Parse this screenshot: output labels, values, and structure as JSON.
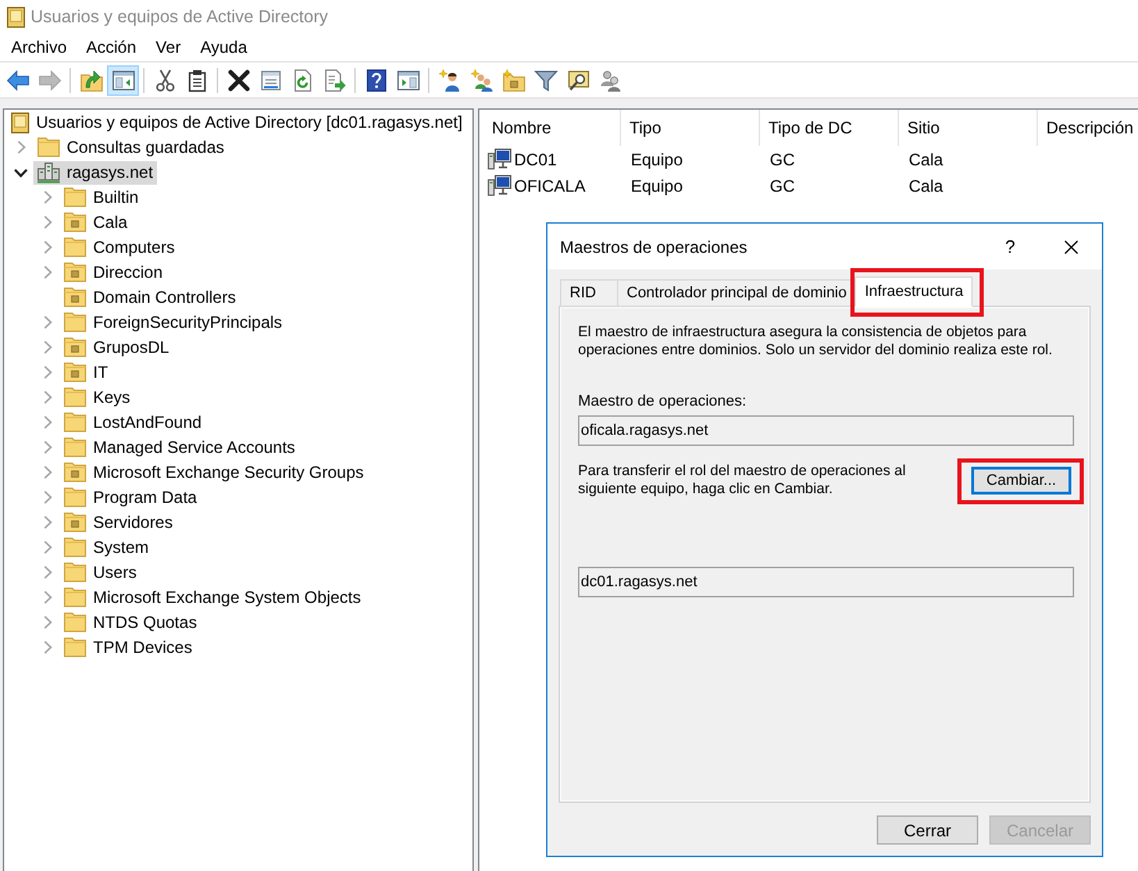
{
  "window": {
    "title": "Usuarios y equipos de Active Directory"
  },
  "menu": [
    "Archivo",
    "Acción",
    "Ver",
    "Ayuda"
  ],
  "toolbar": [
    {
      "kind": "button",
      "disabled": false,
      "pressed": false
    },
    {
      "kind": "button",
      "disabled": true,
      "pressed": false
    },
    {
      "kind": "separator"
    },
    {
      "kind": "button",
      "disabled": false,
      "pressed": false
    },
    {
      "kind": "button",
      "disabled": false,
      "pressed": true
    },
    {
      "kind": "separator"
    },
    {
      "kind": "button",
      "disabled": false,
      "pressed": false
    },
    {
      "kind": "button",
      "disabled": false,
      "pressed": false
    },
    {
      "kind": "separator"
    },
    {
      "kind": "button",
      "disabled": false,
      "pressed": false
    },
    {
      "kind": "button",
      "disabled": false,
      "pressed": false
    },
    {
      "kind": "button",
      "disabled": false,
      "pressed": false
    },
    {
      "kind": "button",
      "disabled": false,
      "pressed": false
    },
    {
      "kind": "separator"
    },
    {
      "kind": "button",
      "disabled": false,
      "pressed": false
    },
    {
      "kind": "button",
      "disabled": false,
      "pressed": false
    },
    {
      "kind": "separator"
    },
    {
      "kind": "button",
      "disabled": false,
      "pressed": false
    },
    {
      "kind": "button",
      "disabled": false,
      "pressed": false
    },
    {
      "kind": "button",
      "disabled": false,
      "pressed": false
    },
    {
      "kind": "button",
      "disabled": false,
      "pressed": false
    },
    {
      "kind": "button",
      "disabled": false,
      "pressed": false
    },
    {
      "kind": "button",
      "disabled": false,
      "pressed": false
    }
  ],
  "tree": {
    "root": {
      "label": "Usuarios y equipos de Active Directory [dc01.ragasys.net]",
      "selected": false
    },
    "items": [
      {
        "label": "Consultas guardadas",
        "kind": "folder",
        "expandable": true,
        "expanded": false,
        "selected": false
      },
      {
        "label": "ragasys.net",
        "kind": "domain",
        "expandable": true,
        "expanded": true,
        "selected": true,
        "children": [
          {
            "label": "Builtin",
            "kind": "folder",
            "expandable": true,
            "expanded": false,
            "selected": false
          },
          {
            "label": "Cala",
            "kind": "ou",
            "expandable": true,
            "expanded": false,
            "selected": false
          },
          {
            "label": "Computers",
            "kind": "folder",
            "expandable": true,
            "expanded": false,
            "selected": false
          },
          {
            "label": "Direccion",
            "kind": "ou",
            "expandable": true,
            "expanded": false,
            "selected": false
          },
          {
            "label": "Domain Controllers",
            "kind": "ou",
            "expandable": false,
            "selected": false
          },
          {
            "label": "ForeignSecurityPrincipals",
            "kind": "folder",
            "expandable": true,
            "expanded": false,
            "selected": false
          },
          {
            "label": "GruposDL",
            "kind": "ou",
            "expandable": true,
            "expanded": false,
            "selected": false
          },
          {
            "label": "IT",
            "kind": "ou",
            "expandable": true,
            "expanded": false,
            "selected": false
          },
          {
            "label": "Keys",
            "kind": "folder",
            "expandable": true,
            "expanded": false,
            "selected": false
          },
          {
            "label": "LostAndFound",
            "kind": "folder",
            "expandable": true,
            "expanded": false,
            "selected": false
          },
          {
            "label": "Managed Service Accounts",
            "kind": "folder",
            "expandable": true,
            "expanded": false,
            "selected": false
          },
          {
            "label": "Microsoft Exchange Security Groups",
            "kind": "ou",
            "expandable": true,
            "expanded": false,
            "selected": false
          },
          {
            "label": "Program Data",
            "kind": "folder",
            "expandable": true,
            "expanded": false,
            "selected": false
          },
          {
            "label": "Servidores",
            "kind": "ou",
            "expandable": true,
            "expanded": false,
            "selected": false
          },
          {
            "label": "System",
            "kind": "folder",
            "expandable": true,
            "expanded": false,
            "selected": false
          },
          {
            "label": "Users",
            "kind": "folder",
            "expandable": true,
            "expanded": false,
            "selected": false
          },
          {
            "label": "Microsoft Exchange System Objects",
            "kind": "folder",
            "expandable": true,
            "expanded": false,
            "selected": false
          },
          {
            "label": "NTDS Quotas",
            "kind": "folder",
            "expandable": true,
            "expanded": false,
            "selected": false
          },
          {
            "label": "TPM Devices",
            "kind": "folder",
            "expandable": true,
            "expanded": false,
            "selected": false
          }
        ]
      }
    ]
  },
  "list": {
    "columns": [
      "Nombre",
      "Tipo",
      "Tipo de DC",
      "Sitio",
      "Descripción"
    ],
    "rows": [
      {
        "cells": [
          "DC01",
          "Equipo",
          "GC",
          "Cala"
        ]
      },
      {
        "cells": [
          "OFICALA",
          "Equipo",
          "GC",
          "Cala"
        ]
      }
    ]
  },
  "dialog": {
    "title": "Maestros de operaciones",
    "help": "?",
    "tabs": [
      {
        "label": "RID",
        "selected": false,
        "highlighted": false
      },
      {
        "label": "Controlador principal de dominio",
        "selected": false,
        "highlighted": false
      },
      {
        "label": "Infraestructura",
        "selected": true,
        "highlighted": true
      }
    ],
    "description": "El maestro de infraestructura asegura la consistencia de objetos para operaciones entre dominios. Solo un servidor del dominio realiza este rol.",
    "master_label": "Maestro de operaciones:",
    "master_value": "oficala.ragasys.net",
    "transfer_text": "Para transferir el rol del maestro de operaciones al siguiente equipo, haga clic en Cambiar.",
    "change_button": {
      "label": "Cambiar...",
      "focused": true,
      "highlighted": true
    },
    "target_value": "dc01.ragasys.net",
    "buttons": [
      {
        "label": "Cerrar",
        "disabled": false
      },
      {
        "label": "Cancelar",
        "disabled": true
      }
    ]
  }
}
